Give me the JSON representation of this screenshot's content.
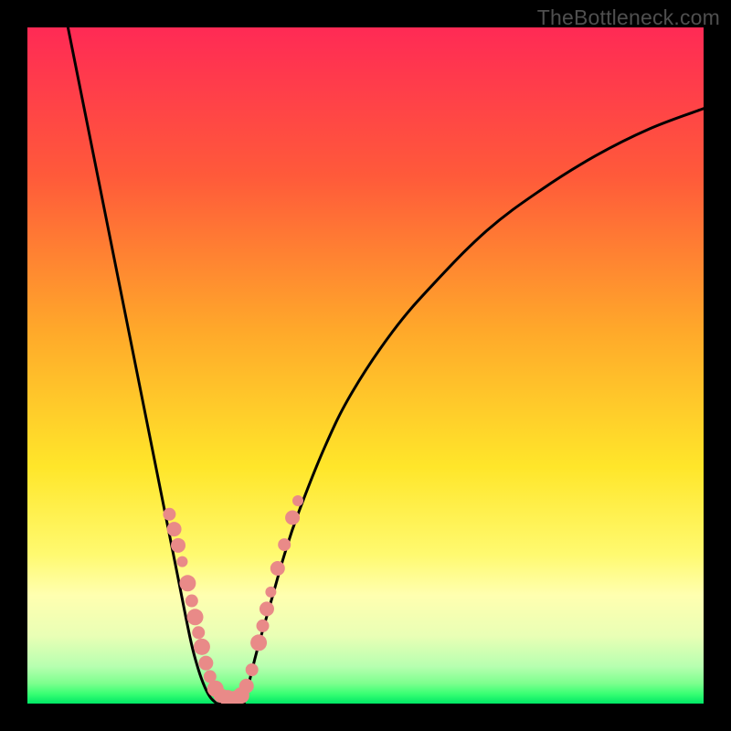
{
  "watermark": "TheBottleneck.com",
  "chart_data": {
    "type": "line",
    "title": "",
    "xlabel": "",
    "ylabel": "",
    "xlim": [
      0,
      100
    ],
    "ylim": [
      0,
      100
    ],
    "gradient_stops": [
      {
        "offset": 0,
        "color": "#ff2a55"
      },
      {
        "offset": 0.22,
        "color": "#ff5a3a"
      },
      {
        "offset": 0.45,
        "color": "#ffa92a"
      },
      {
        "offset": 0.65,
        "color": "#ffe62a"
      },
      {
        "offset": 0.78,
        "color": "#fffa70"
      },
      {
        "offset": 0.84,
        "color": "#ffffb0"
      },
      {
        "offset": 0.9,
        "color": "#e9ffb5"
      },
      {
        "offset": 0.945,
        "color": "#b7ffb0"
      },
      {
        "offset": 0.97,
        "color": "#7dff8e"
      },
      {
        "offset": 0.985,
        "color": "#3bff74"
      },
      {
        "offset": 1.0,
        "color": "#00e865"
      }
    ],
    "series": [
      {
        "name": "curve-left",
        "x": [
          6,
          8,
          10,
          12,
          14,
          16,
          18,
          20,
          22,
          24,
          25,
          26,
          27,
          28
        ],
        "y": [
          100,
          90,
          80,
          70,
          60,
          50,
          40,
          30,
          20,
          10,
          6,
          3,
          1,
          0
        ]
      },
      {
        "name": "curve-right",
        "x": [
          32,
          33,
          34,
          36,
          38,
          40,
          44,
          48,
          54,
          60,
          68,
          76,
          84,
          92,
          100
        ],
        "y": [
          0,
          4,
          8,
          15,
          22,
          28,
          38,
          46,
          55,
          62,
          70,
          76,
          81,
          85,
          88
        ]
      },
      {
        "name": "valley-floor",
        "x": [
          28,
          30,
          32
        ],
        "y": [
          0,
          0,
          0
        ]
      }
    ],
    "markers": {
      "color": "#e98a88",
      "points": [
        {
          "x": 21.0,
          "y": 28.0,
          "r": 7
        },
        {
          "x": 21.7,
          "y": 25.8,
          "r": 8
        },
        {
          "x": 22.3,
          "y": 23.4,
          "r": 8
        },
        {
          "x": 22.9,
          "y": 21.0,
          "r": 6
        },
        {
          "x": 23.7,
          "y": 17.8,
          "r": 9
        },
        {
          "x": 24.3,
          "y": 15.2,
          "r": 7
        },
        {
          "x": 24.8,
          "y": 12.8,
          "r": 9
        },
        {
          "x": 25.3,
          "y": 10.5,
          "r": 7
        },
        {
          "x": 25.8,
          "y": 8.4,
          "r": 9
        },
        {
          "x": 26.4,
          "y": 6.0,
          "r": 8
        },
        {
          "x": 27.0,
          "y": 4.0,
          "r": 7
        },
        {
          "x": 27.8,
          "y": 2.2,
          "r": 9
        },
        {
          "x": 28.6,
          "y": 1.2,
          "r": 8
        },
        {
          "x": 29.6,
          "y": 0.8,
          "r": 9
        },
        {
          "x": 30.6,
          "y": 0.8,
          "r": 8
        },
        {
          "x": 31.6,
          "y": 1.2,
          "r": 9
        },
        {
          "x": 32.4,
          "y": 2.6,
          "r": 8
        },
        {
          "x": 33.2,
          "y": 5.0,
          "r": 7
        },
        {
          "x": 34.2,
          "y": 9.0,
          "r": 9
        },
        {
          "x": 34.8,
          "y": 11.5,
          "r": 7
        },
        {
          "x": 35.4,
          "y": 14.0,
          "r": 8
        },
        {
          "x": 36.0,
          "y": 16.5,
          "r": 6
        },
        {
          "x": 37.0,
          "y": 20.0,
          "r": 8
        },
        {
          "x": 38.0,
          "y": 23.5,
          "r": 7
        },
        {
          "x": 39.2,
          "y": 27.5,
          "r": 8
        },
        {
          "x": 40.0,
          "y": 30.0,
          "r": 6
        }
      ]
    }
  }
}
